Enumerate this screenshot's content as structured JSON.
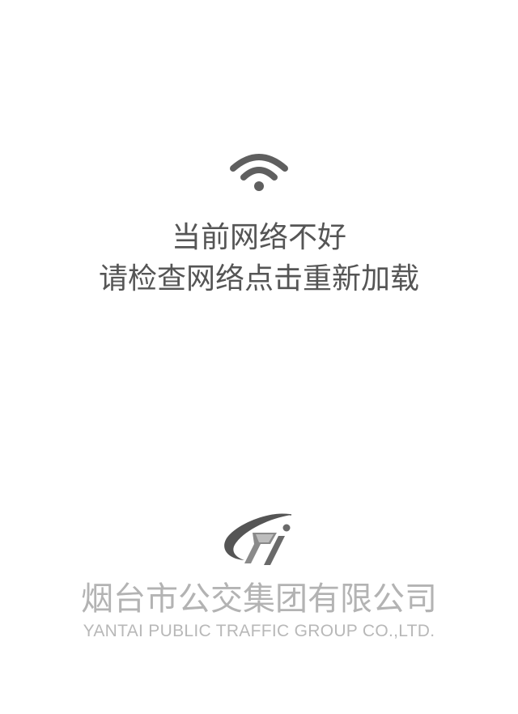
{
  "icons": {
    "wifi": "wifi-icon",
    "logo": "company-logo"
  },
  "colors": {
    "icon": "#5f5f5f",
    "message_text": "#555555",
    "company_text": "#b3b3b3",
    "background": "#ffffff"
  },
  "error": {
    "title": "当前网络不好",
    "instruction": "请检查网络点击重新加载"
  },
  "company": {
    "name_cn": "烟台市公交集团有限公司",
    "name_en": "YANTAI PUBLIC TRAFFIC GROUP CO.,LTD."
  }
}
